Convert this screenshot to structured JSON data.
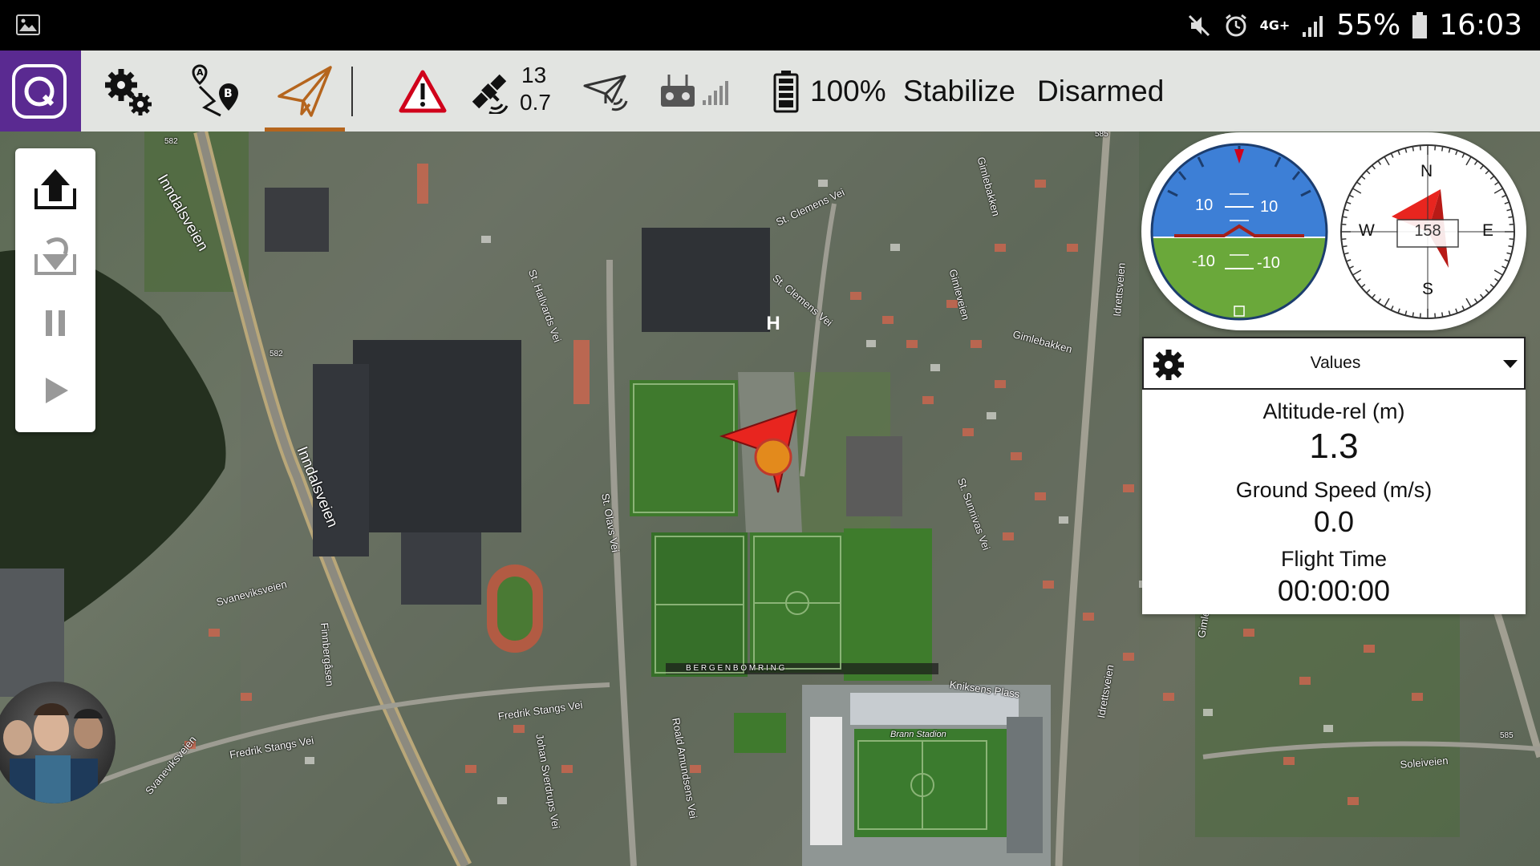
{
  "status_bar": {
    "network": "4G+",
    "battery": "55%",
    "time": "16:03"
  },
  "toolbar": {
    "satellites": "13",
    "hdop": "0.7",
    "battery_level": "100%",
    "flight_mode": "Stabilize",
    "arm_state": "Disarmed"
  },
  "map": {
    "labels": [
      "Inndalsveien",
      "Inndalsveien",
      "St. Clemens Vei",
      "St. Clemens Vei",
      "St. Olavs Vei",
      "St. Hallvards Vei",
      "Gimlebakken",
      "Gimlebakken",
      "Gimleveien",
      "Gimleveien",
      "Idrettsveien",
      "Idrettsveien",
      "St. Sunnivas Vei",
      "Svaneviksveien",
      "Fredrik Stangs Vei",
      "Fredrik Stangs Vei",
      "Finnbergåsen",
      "Roald Amundsens Vei",
      "Johan Sverdrups Vei",
      "Kniksens Plass",
      "Brann Stadion",
      "B E R G E N   B O M R I N G",
      "Soleiveien",
      "Svaneviksveien",
      "585",
      "582",
      "582",
      "585"
    ],
    "home_marker": "H"
  },
  "attitude": {
    "pitch_labels": [
      "10",
      "10",
      "-10",
      "-10"
    ],
    "sky_color": "#3d7fd6",
    "ground_color": "#6aa83a"
  },
  "compass": {
    "heading": "158",
    "north": "N",
    "east": "E",
    "south": "S",
    "west": "W"
  },
  "telemetry": {
    "header": "Values",
    "items": [
      {
        "label": "Altitude-rel (m)",
        "value": "1.3"
      },
      {
        "label": "Ground Speed (m/s)",
        "value": "0.0"
      },
      {
        "label": "Flight Time",
        "value": "00:00:00"
      }
    ]
  },
  "colors": {
    "brand_purple": "#5a2a91",
    "active_accent": "#b5651d",
    "warning_red": "#d0021b",
    "vehicle_red": "#e8251f",
    "home_orange": "#e38a1c"
  }
}
